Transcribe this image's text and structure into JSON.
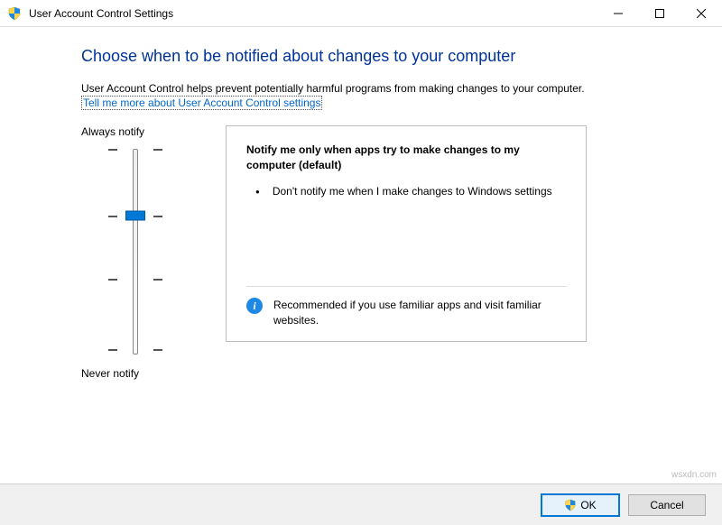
{
  "window": {
    "title": "User Account Control Settings"
  },
  "main": {
    "heading": "Choose when to be notified about changes to your computer",
    "description": "User Account Control helps prevent potentially harmful programs from making changes to your computer.",
    "link_text": "Tell me more about User Account Control settings"
  },
  "slider": {
    "top_label": "Always notify",
    "bottom_label": "Never notify",
    "levels": 4,
    "current_level": 1
  },
  "panel": {
    "heading": "Notify me only when apps try to make changes to my computer (default)",
    "bullet": "Don't notify me when I make changes to Windows settings",
    "footer": "Recommended if you use familiar apps and visit familiar websites."
  },
  "buttons": {
    "ok": "OK",
    "cancel": "Cancel"
  },
  "watermark": "wsxdn.com"
}
